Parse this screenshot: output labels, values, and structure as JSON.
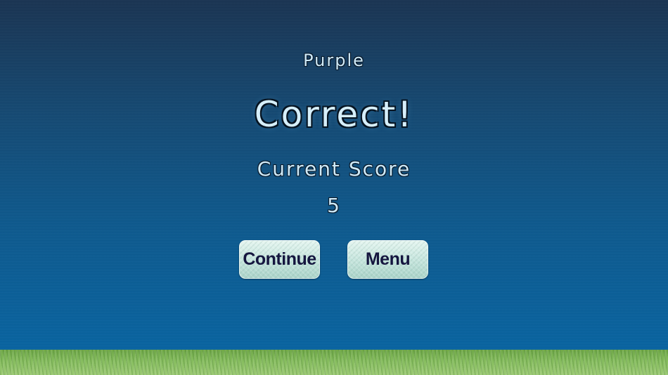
{
  "prompt": {
    "color_word": "Purple"
  },
  "result": {
    "message": "Correct!"
  },
  "score": {
    "label": "Current Score",
    "value": "5"
  },
  "buttons": {
    "continue_label": "Continue",
    "menu_label": "Menu"
  },
  "colors": {
    "sky_top": "#1b3553",
    "sky_bottom": "#0a64a0",
    "text": "#cfeaf8",
    "button_text": "#15163f",
    "button_fill": "#c7e6de",
    "grass": "#86bd5e"
  }
}
